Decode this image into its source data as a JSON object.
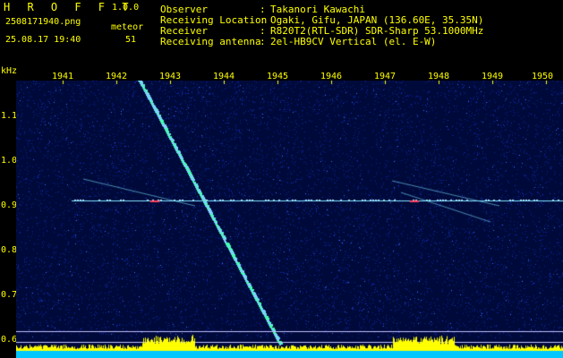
{
  "app": {
    "name": "H R O F F T",
    "version": "1.0.0"
  },
  "file": {
    "name": "2508171940.png",
    "datetime": "25.08.17 19:40"
  },
  "counter": {
    "label": "meteor",
    "value": "51"
  },
  "info": [
    {
      "label": "Observer",
      "value": "Takanori Kawachi"
    },
    {
      "label": "Receiving Location",
      "value": "Ogaki, Gifu, JAPAN (136.60E, 35.35N)"
    },
    {
      "label": "Receiver",
      "value": "R820T2(RTL-SDR) SDR-Sharp 53.1000MHz"
    },
    {
      "label": "Receiving antenna",
      "value": "2el-HB9CV Vertical (el. E-W)"
    }
  ],
  "axis": {
    "y_unit": "kHz",
    "x_ticks": [
      "1941",
      "1942",
      "1943",
      "1944",
      "1945",
      "1946",
      "1947",
      "1948",
      "1949",
      "1950"
    ],
    "y_ticks": [
      "1.1",
      "1.0",
      "0.9",
      "0.8",
      "0.7",
      "0.6"
    ]
  },
  "colors": {
    "text": "#ffff00",
    "background": "#000000",
    "noise": "#0a1a8c",
    "carrier": "#7fe0ff",
    "spectrum": "#ffff00",
    "baseline": "#00c8ff"
  }
}
